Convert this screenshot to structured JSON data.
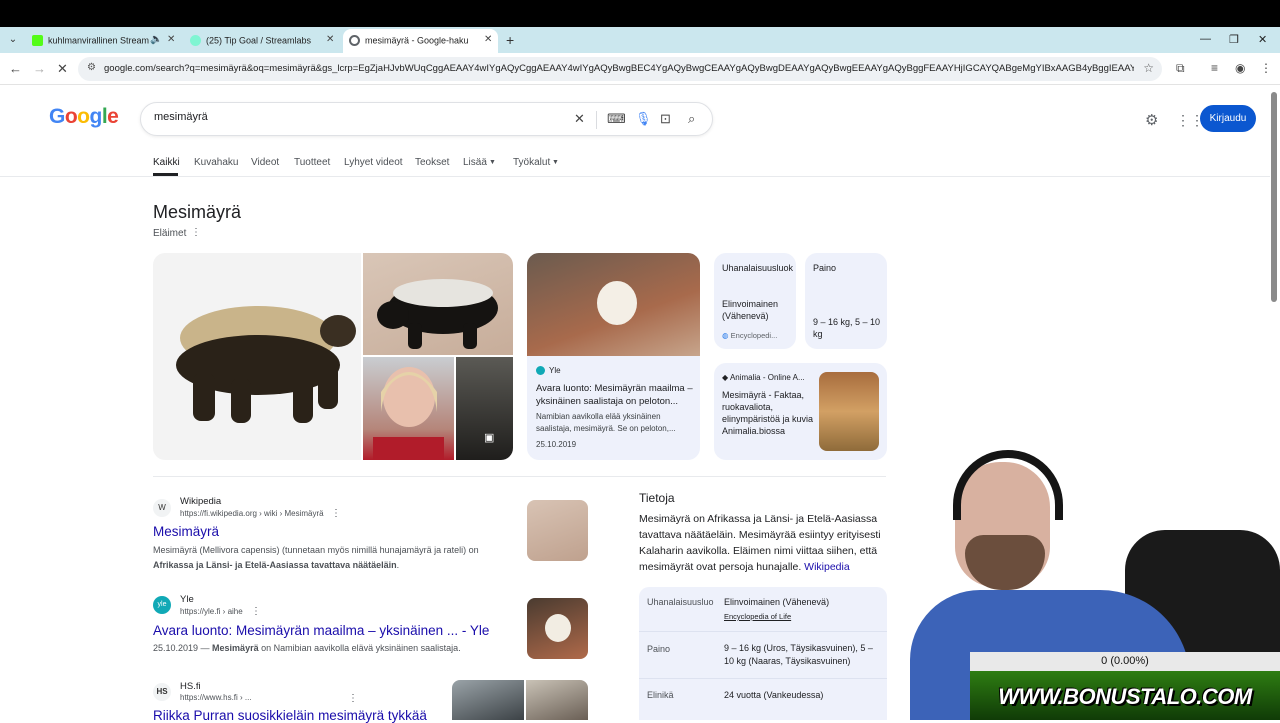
{
  "browser": {
    "tabs": [
      {
        "title": "kuhlmanvirallinen Stream -",
        "favicon_color": "#53fc18"
      },
      {
        "title": "(25) Tip Goal / Streamlabs",
        "favicon_color": "#80f5d2"
      },
      {
        "title": "mesimäyrä - Google-haku",
        "favicon_color": "#5f6368"
      }
    ],
    "url": "google.com/search?q=mesimäyrä&oq=mesimäyrä&gs_lcrp=EgZjaHJvbWUqCggAEAAY4wIYgAQyCggAEAAY4wIYgAQyBwgBEC4YgAQyBwgCEAAYgAQyBwgDEAAYgAQyBwgEEAAYgAQyBggFEAAYHjIGCAYQABgeMgYIBxAAGB4yBggIEAAYHjIGCAkQABg..."
  },
  "google": {
    "logo_letters": [
      {
        "ch": "G",
        "color": "#4285f4"
      },
      {
        "ch": "o",
        "color": "#ea4335"
      },
      {
        "ch": "o",
        "color": "#fbbc05"
      },
      {
        "ch": "g",
        "color": "#4285f4"
      },
      {
        "ch": "l",
        "color": "#34a853"
      },
      {
        "ch": "e",
        "color": "#ea4335"
      }
    ],
    "query": "mesimäyrä",
    "signin_label": "Kirjaudu",
    "nav_tabs": [
      "Kaikki",
      "Kuvahaku",
      "Videot",
      "Tuotteet",
      "Lyhyet videot",
      "Teokset",
      "Lisää",
      "Työkalut"
    ]
  },
  "knowledge_panel": {
    "title": "Mesimäyrä",
    "subtitle": "Eläimet",
    "yle_card": {
      "source": "Yle",
      "title": "Avara luonto: Mesimäyrän maailma – yksinäinen saalistaja on peloton...",
      "description": "Namibian aavikolla elää yksinäinen saalistaja, mesimäyrä. Se on peloton,...",
      "date": "25.10.2019"
    },
    "fact_uhanalaisuus": {
      "label": "Uhanalaisuusluok",
      "value": "Elinvoimainen (Vähenevä)",
      "source": "Encyclopedi..."
    },
    "fact_paino": {
      "label": "Paino",
      "value": "9 – 16 kg, 5 – 10 kg"
    },
    "animalia_card": {
      "source": "Animalia - Online A...",
      "title": "Mesimäyrä - Faktaa, ruokavaliota, elinympäristöä ja kuvia Animalia.biossa"
    }
  },
  "results": [
    {
      "site": "Wikipedia",
      "favicon": "W",
      "url": "https://fi.wikipedia.org › wiki › Mesimäyrä",
      "title": "Mesimäyrä",
      "snippet_1": "Mesimäyrä (Mellivora capensis) (tunnetaan myös nimillä hunajamäyrä ja rateli) on ",
      "snippet_bold": "Afrikassa ja Länsi- ja Etelä-Aasiassa tavattava näätäeläin",
      "snippet_2": "."
    },
    {
      "site": "Yle",
      "favicon": "yle",
      "url": "https://yle.fi › aihe",
      "title": "Avara luonto: Mesimäyrän maailma – yksinäinen ... - Yle",
      "snippet_1": "25.10.2019 — ",
      "snippet_bold": "Mesimäyrä",
      "snippet_2": " on Namibian aavikolla elävä yksinäinen saalistaja."
    },
    {
      "site": "HS.fi",
      "favicon": "HS",
      "url": "https://www.hs.fi › ...",
      "title": "Riikka Purran suosikkieläin mesimäyrä tykkää"
    }
  ],
  "tietoja": {
    "title": "Tietoja",
    "text": "Mesimäyrä on Afrikassa ja Länsi- ja Etelä-Aasiassa tavattava näätäeläin. Mesimäyrää esiintyy erityisesti Kalaharin aavikolla. Eläimen nimi viittaa siihen, että mesimäyrät ovat persoja hunajalle. ",
    "link": "Wikipedia",
    "rows": [
      {
        "key": "Uhanalaisuusluo",
        "value": "Elinvoimainen (Vähenevä)",
        "source": "Encyclopedia of Life"
      },
      {
        "key": "Paino",
        "value": "9 – 16 kg (Uros, Täysikasvuinen), 5 – 10 kg (Naaras, Täysikasvuinen)"
      },
      {
        "key": "Elinikä",
        "value": "24 vuotta (Vankeudessa)"
      }
    ]
  },
  "overlay": {
    "goal": "0 (0.00%)",
    "banner": "WWW.BONUSTALO.COM"
  }
}
